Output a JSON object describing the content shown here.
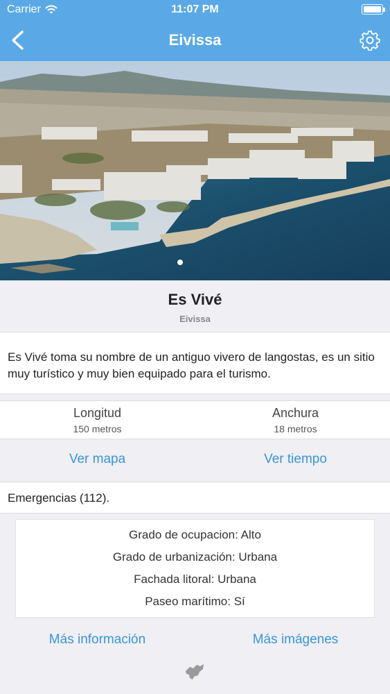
{
  "status_bar": {
    "carrier": "Carrier",
    "time": "11:07 PM"
  },
  "nav": {
    "title": "Eivissa",
    "back_icon": "back-chevron-icon",
    "settings_icon": "gear-icon"
  },
  "hero": {
    "page_count": 1,
    "current_page": 1
  },
  "beach": {
    "name": "Es Vivé",
    "island": "Eivissa"
  },
  "description": "Es Vivé toma su nombre de un antiguo vivero de langostas, es un sitio muy turístico y muy bien equipado para el turismo.",
  "dimensions": {
    "length_label": "Longitud",
    "length_value": "150 metros",
    "width_label": "Anchura",
    "width_value": "18 metros"
  },
  "actions": {
    "map": "Ver mapa",
    "weather": "Ver tiempo"
  },
  "emergency": "Emergencias (112).",
  "details": {
    "occupancy": "Grado de ocupacion: Alto",
    "urbanization": "Grado de urbanización: Urbana",
    "seafront": "Fachada litoral: Urbana",
    "promenade": "Paseo marítimo: Sí"
  },
  "footer_links": {
    "more_info": "Más información",
    "more_images": "Más imágenes"
  },
  "colors": {
    "nav_bar": "#5aa9e6",
    "link": "#3a95d8",
    "background": "#efeff4"
  }
}
